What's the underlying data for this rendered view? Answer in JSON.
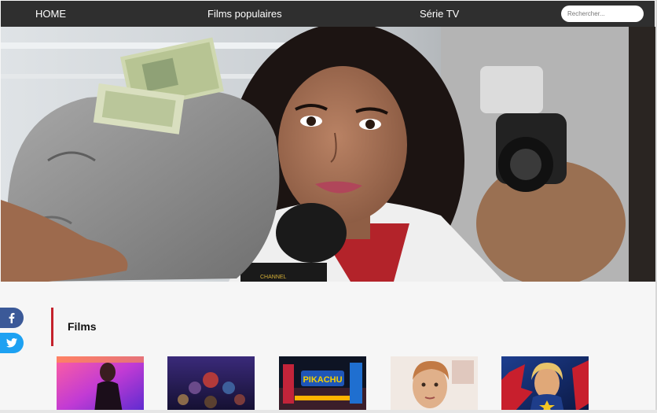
{
  "nav": {
    "home": "HOME",
    "popular": "Films populaires",
    "series": "Série TV",
    "search_placeholder": "Rechercher..."
  },
  "hero": {
    "sign_text": "CHANNEL"
  },
  "social": {
    "facebook_icon": "facebook-icon",
    "twitter_icon": "twitter-icon"
  },
  "section": {
    "title": "Films"
  },
  "posters": [
    {
      "subject": "John Wick",
      "text": ""
    },
    {
      "subject": "Avengers",
      "text": ""
    },
    {
      "subject": "Pikachu",
      "text": "PIKACHU"
    },
    {
      "subject": "portrait",
      "text": ""
    },
    {
      "subject": "Captain Marvel",
      "text": ""
    }
  ],
  "colors": {
    "navbar": "#2f2f2f",
    "section_accent": "#c4222c",
    "facebook": "#3b5998",
    "twitter": "#1da1f2"
  }
}
